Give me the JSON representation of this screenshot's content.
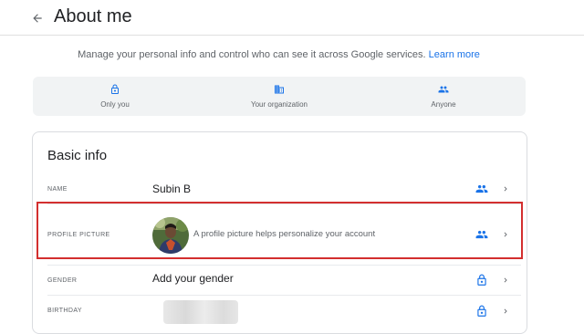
{
  "header": {
    "title": "About me",
    "back_icon": "arrow-back-icon"
  },
  "intro": {
    "text": "Manage your personal info and control who can see it across Google services.",
    "link": "Learn more"
  },
  "legend": [
    {
      "icon": "lock-icon",
      "label": "Only you"
    },
    {
      "icon": "organization-icon",
      "label": "Your organization"
    },
    {
      "icon": "people-icon",
      "label": "Anyone"
    }
  ],
  "basic_info": {
    "title": "Basic info",
    "rows": {
      "name": {
        "label": "NAME",
        "value": "Subin B",
        "visibility_icon": "people-icon"
      },
      "profile_picture": {
        "label": "PROFILE PICTURE",
        "hint": "A profile picture helps personalize your account",
        "visibility_icon": "people-icon"
      },
      "gender": {
        "label": "GENDER",
        "value": "Add your gender",
        "visibility_icon": "lock-icon"
      },
      "birthday": {
        "label": "BIRTHDAY",
        "value": "",
        "visibility_icon": "lock-icon"
      }
    }
  },
  "colors": {
    "accent": "#1a73e8",
    "highlight": "#d32f2f",
    "legend_bg": "#f1f3f4"
  }
}
